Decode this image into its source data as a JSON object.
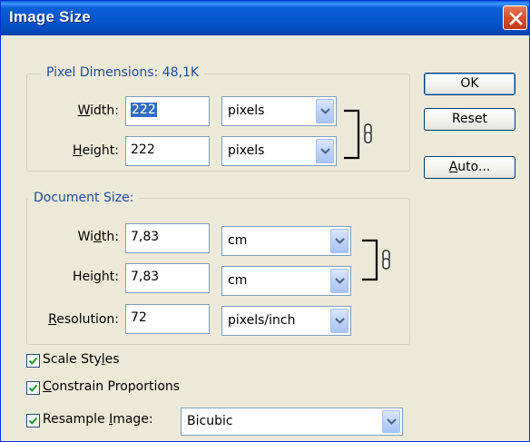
{
  "window": {
    "title": "Image Size"
  },
  "pixel_dimensions": {
    "legend": "Pixel Dimensions:  48,1K",
    "width_label_prefix": "",
    "width_label_mnemonic": "W",
    "width_label_rest": "idth:",
    "width_value": "222",
    "width_unit": "pixels",
    "height_label_mnemonic": "H",
    "height_label_rest": "eight:",
    "height_value": "222",
    "height_unit": "pixels"
  },
  "document_size": {
    "legend": "Document Size:",
    "width_label_prefix": "Wi",
    "width_label_mnemonic": "d",
    "width_label_rest": "th:",
    "width_value": "7,83",
    "width_unit": "cm",
    "height_label_prefix": "Hei",
    "height_label_mnemonic": "g",
    "height_label_rest": "ht:",
    "height_value": "7,83",
    "height_unit": "cm",
    "resolution_label_mnemonic": "R",
    "resolution_label_rest": "esolution:",
    "resolution_value": "72",
    "resolution_unit": "pixels/inch"
  },
  "buttons": {
    "ok": "OK",
    "reset": "Reset",
    "auto_mnemonic": "A",
    "auto_rest": "uto..."
  },
  "options": {
    "scale_styles_prefix": "Scale Sty",
    "scale_styles_mnemonic": "l",
    "scale_styles_rest": "es",
    "scale_styles_checked": true,
    "constrain_mnemonic": "C",
    "constrain_rest": "onstrain Proportions",
    "constrain_checked": true,
    "resample_prefix": "Resample ",
    "resample_mnemonic": "I",
    "resample_rest": "mage:",
    "resample_checked": true,
    "resample_method": "Bicubic"
  },
  "colors": {
    "titlebar": "#0654cf",
    "legend_text": "#1e4da1",
    "selection": "#316ac5",
    "dialog_bg": "#ece9d8"
  },
  "icons": [
    "close-icon",
    "link-chain-icon",
    "dropdown-arrow-icon",
    "checkmark-icon"
  ]
}
